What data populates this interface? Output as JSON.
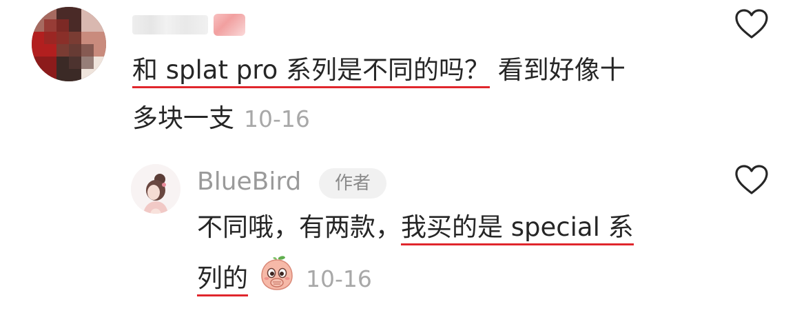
{
  "comment": {
    "avatar_icon": "blurred-avatar-icon",
    "text_line1_highlight": "和 splat pro 系列是不同的吗？",
    "text_line1_rest": " 看到好像十",
    "text_line2": "多块一支",
    "date": "10-16"
  },
  "reply": {
    "avatar_icon": "girl-avatar-icon",
    "author": "BlueBird",
    "author_badge": "作者",
    "text_line1_plain": "不同哦，有两款，",
    "text_line1_highlight": "我买的是 special 系",
    "text_line2_highlight": "列的",
    "emoji": "covering-mouth-face-emoji",
    "date": "10-16"
  },
  "icons": {
    "like": "heart-outline-icon"
  },
  "colors": {
    "highlight_underline": "#e0262c",
    "muted_text": "#a8a8a8",
    "badge_bg": "#f1f1f1"
  }
}
